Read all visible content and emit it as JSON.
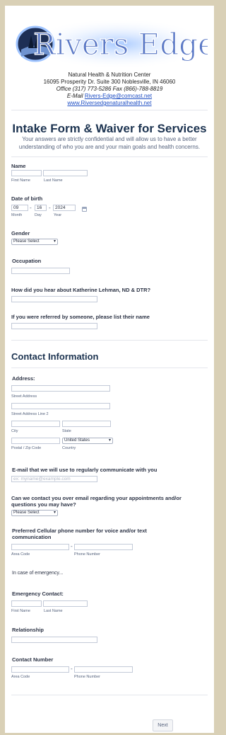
{
  "header": {
    "logo_text": "Rivers Edge",
    "address_lines": [
      "Natural Health & Nutrition Center",
      "16095 Prosperity Dr. Suite 300 Noblesville, IN  46060"
    ],
    "phone": "Office (317) 773-5286   Fax (866)-788-8819",
    "email_label": "E-Mail",
    "email": "Rivers-Edge@comcast.net",
    "website": "www.Riversedgenaturalhealth.net"
  },
  "form": {
    "title": "Intake Form & Waiver for Services",
    "subtitle": "Your answers are strictly confidential and will allow us to have a better understanding of who you are and your main goals and health concerns.",
    "name": {
      "label": "Name",
      "first": "First Name",
      "last": "Last Name"
    },
    "dob": {
      "label": "Date of birth",
      "month": "09",
      "day": "16",
      "year": "2024",
      "month_label": "Month",
      "day_label": "Day",
      "year_label": "Year",
      "sep": "-"
    },
    "gender": {
      "label": "Gender",
      "selected": "Please Select"
    },
    "occupation": {
      "label": "Occupation"
    },
    "heard": {
      "label": "How did you hear about Katherine Lehman, ND & DTR?"
    },
    "referred": {
      "label": "If you were referred by someone, please list their name"
    },
    "contact_heading": "Contact Information",
    "address": {
      "label": "Address:",
      "street": "Street Address",
      "street2": "Street Address Line 2",
      "city": "City",
      "state": "State",
      "postal": "Postal / Zip Code",
      "country_label": "Country",
      "country": "United States"
    },
    "email": {
      "label": "E-mail that we will use to regularly communicate with you",
      "placeholder": "ex: myname@example.com"
    },
    "email_ok": {
      "label": "Can we contact you over email regarding your appointments and/or questions you may have?",
      "selected": "Please Select"
    },
    "cell": {
      "label": "Preferred Cellular phone number for voice and/or text communication",
      "area": "Area Code",
      "phone": "Phone Number",
      "sep": "-"
    },
    "emergency_note": "In case of emergency...",
    "emergency": {
      "label": "Emergency Contact:",
      "first": "First Name",
      "last": "Last Name"
    },
    "relationship": {
      "label": "Relationship"
    },
    "contact_number": {
      "label": "Contact Number",
      "area": "Area Code",
      "phone": "Phone Number",
      "sep": "-"
    },
    "next_label": "Next"
  }
}
